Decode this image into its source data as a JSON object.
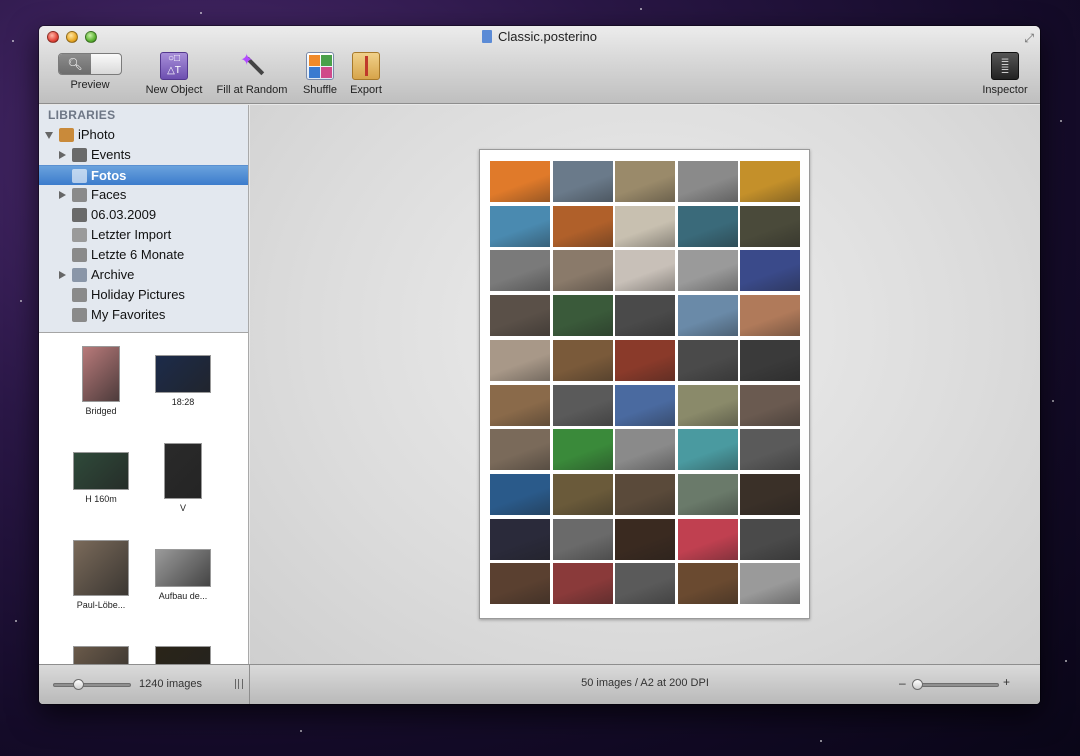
{
  "window": {
    "title": "Classic.posterino"
  },
  "toolbar": {
    "preview_label": "Preview",
    "new_object_label": "New Object",
    "fill_random_label": "Fill at Random",
    "shuffle_label": "Shuffle",
    "export_label": "Export",
    "inspector_label": "Inspector"
  },
  "sidebar": {
    "header": "LIBRARIES",
    "items": [
      {
        "label": "iPhoto",
        "disclosure": "down",
        "icon": "iphoto-icon",
        "selected": false
      },
      {
        "label": "Events",
        "disclosure": "right",
        "icon": "palm-tree-icon",
        "selected": false
      },
      {
        "label": "Fotos",
        "disclosure": "none",
        "icon": "photos-icon",
        "selected": true
      },
      {
        "label": "Faces",
        "disclosure": "right",
        "icon": "person-icon",
        "selected": false
      },
      {
        "label": "06.03.2009",
        "disclosure": "none",
        "icon": "palm-tree-icon",
        "selected": false
      },
      {
        "label": "Letzter Import",
        "disclosure": "none",
        "icon": "clock-icon",
        "selected": false
      },
      {
        "label": "Letzte 6 Monate",
        "disclosure": "none",
        "icon": "calendar-icon",
        "selected": false
      },
      {
        "label": "Archive",
        "disclosure": "right",
        "icon": "folder-icon",
        "selected": false
      },
      {
        "label": "Holiday Pictures",
        "disclosure": "none",
        "icon": "smart-album-icon",
        "selected": false
      },
      {
        "label": "My Favorites",
        "disclosure": "none",
        "icon": "smart-album-icon",
        "selected": false
      }
    ]
  },
  "browser": {
    "thumbnails": [
      {
        "label": "Bridged",
        "color": "#b87a7a"
      },
      {
        "label": "18:28",
        "color": "#1c2b4a"
      },
      {
        "label": "H 160m",
        "color": "#2f4a3a"
      },
      {
        "label": "V",
        "color": "#2a2a2a"
      },
      {
        "label": "Paul-Löbe...",
        "color": "#7a6a5a"
      },
      {
        "label": "Aufbau de...",
        "color": "#9a9a9a"
      },
      {
        "label": "",
        "color": "#6a5a4a"
      },
      {
        "label": "",
        "color": "#2a2418"
      }
    ],
    "image_count": "1240 images"
  },
  "status": {
    "summary": "50 images / A2 at 200 DPI",
    "zoom_minus": "–",
    "zoom_plus": "+"
  },
  "poster": {
    "colors": [
      "#e07a2a",
      "#6a7a8a",
      "#9a8a6a",
      "#8a8a8a",
      "#c4902a",
      "#4a8ab0",
      "#b0602a",
      "#c8c0b0",
      "#3a6a7a",
      "#4a4a3a",
      "#7a7a7a",
      "#8a7a6a",
      "#c8c0b8",
      "#9a9a9a",
      "#3a4a8a",
      "#5a5048",
      "#3a5a3a",
      "#4a4a4a",
      "#6a8aa8",
      "#b07a5a",
      "#a89888",
      "#7a5a3a",
      "#8a3a2a",
      "#4a4a4a",
      "#3a3a3a",
      "#8a6a4a",
      "#5a5a5a",
      "#4a6aa0",
      "#8a8a6a",
      "#6a5a50",
      "#7a6a5a",
      "#3a8a3a",
      "#8a8a8a",
      "#4a9aa0",
      "#5a5a5a",
      "#2a5a8a",
      "#6a5a3a",
      "#5a4a3a",
      "#6a7a6a",
      "#3a3028",
      "#2a2a3a",
      "#6a6a6a",
      "#3a2a20",
      "#c04050",
      "#4a4a4a",
      "#5a4030",
      "#8a3a3a",
      "#5a5a5a",
      "#6a4a30",
      "#9a9a9a"
    ]
  }
}
